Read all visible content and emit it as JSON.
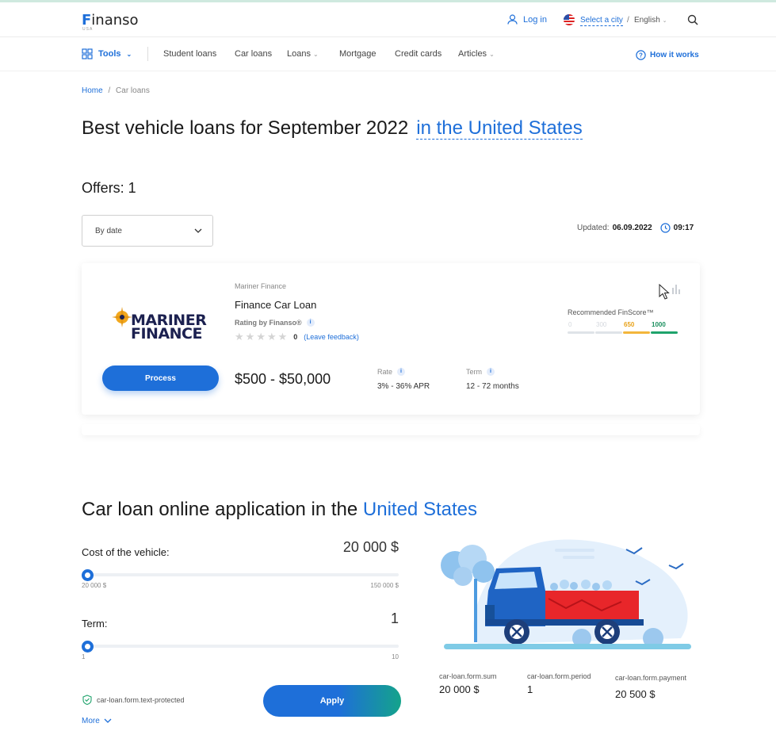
{
  "header": {
    "logo_text": "inanso",
    "logo_letter": "F",
    "logo_sub": "USA",
    "login": "Log in",
    "city": "Select a city",
    "separator": "/",
    "language": "English"
  },
  "nav": {
    "tools": "Tools",
    "items": [
      "Student loans",
      "Car loans",
      "Loans",
      "Mortgage",
      "Credit cards",
      "Articles"
    ],
    "how_it_works": "How it works"
  },
  "breadcrumb": {
    "home": "Home",
    "separator": "/",
    "current": "Car loans"
  },
  "page_title": {
    "main": "Best vehicle loans for September 2022",
    "location": "in the United States"
  },
  "offers_count": "Offers: 1",
  "sort": {
    "selected": "By date"
  },
  "updated": {
    "label": "Updated:",
    "date": "06.09.2022",
    "time": "09:17"
  },
  "offer": {
    "brand_line1": "MARINER",
    "brand_line2": "FINANCE",
    "lender": "Mariner Finance",
    "product": "Finance Car Loan",
    "rating_label": "Rating by Finanso®",
    "stars_filled": 0,
    "stars_total": 5,
    "review_count": "0",
    "leave_feedback": "(Leave feedback)",
    "process_label": "Process",
    "amount": "$500 - $50,000",
    "rate_label": "Rate",
    "rate_value": "3% - 36% APR",
    "term_label": "Term",
    "term_value": "12 - 72 months",
    "finscore_title": "Recommended FinScore™",
    "finscore_scale": [
      {
        "label": "0",
        "color": "#dfe3e8",
        "text_color": "#d5d9de"
      },
      {
        "label": "300",
        "color": "#dfe3e8",
        "text_color": "#d5d9de"
      },
      {
        "label": "650",
        "color": "#f3b63b",
        "text_color": "#e8a21a"
      },
      {
        "label": "1000",
        "color": "#1fa36c",
        "text_color": "#1b8f5e"
      }
    ]
  },
  "application": {
    "title": "Car loan online application in the",
    "title_location": "United States",
    "cost_label": "Cost of the vehicle:",
    "cost_value": "20 000 $",
    "cost_min": "20 000 $",
    "cost_max": "150 000 $",
    "cost_position": 0,
    "term_label": "Term:",
    "term_value": "1",
    "term_min": "1",
    "term_max": "10",
    "term_position": 0,
    "protected_text": "car-loan.form.text-protected",
    "apply_label": "Apply",
    "more_label": "More",
    "results": [
      {
        "label": "car-loan.form.sum",
        "value": "20 000 $"
      },
      {
        "label": "car-loan.form.period",
        "value": "1"
      },
      {
        "label": "car-loan.form.payment",
        "value": "20 500 $"
      }
    ]
  },
  "colors": {
    "accent": "#1e6fd9",
    "text": "#1a1a1a",
    "green": "#14a38b"
  }
}
